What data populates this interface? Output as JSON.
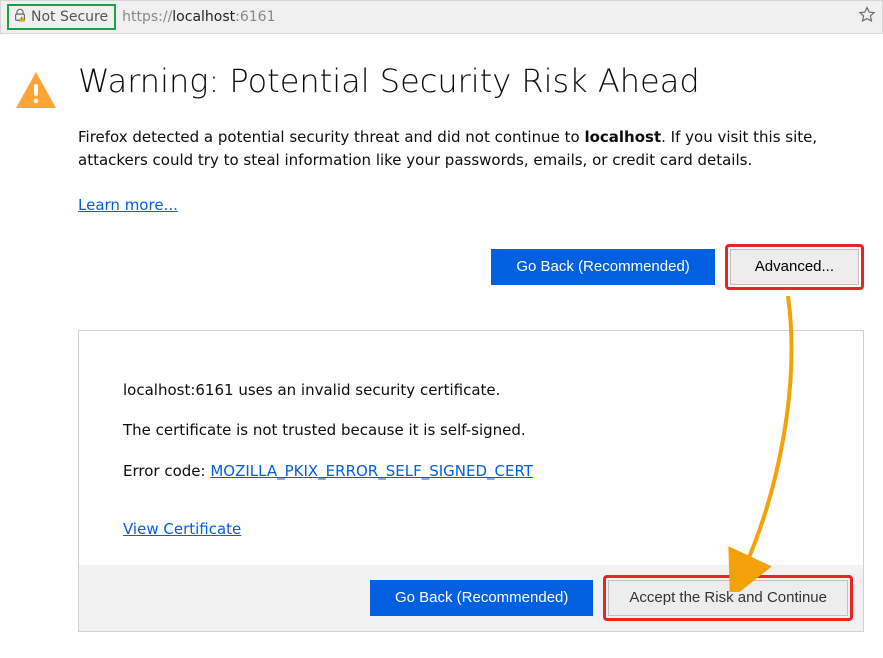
{
  "addressBar": {
    "notSecureLabel": "Not Secure",
    "urlProto": "https://",
    "urlHost": "localhost",
    "urlRest": ":6161"
  },
  "main": {
    "title": "Warning: Potential Security Risk Ahead",
    "warning_pre": "Firefox detected a potential security threat and did not continue to ",
    "warning_host": "localhost",
    "warning_post": ". If you visit this site, attackers could try to steal information like your passwords, emails, or credit card details.",
    "learnMore": "Learn more...",
    "goBack": "Go Back (Recommended)",
    "advanced": "Advanced..."
  },
  "details": {
    "line1": "localhost:6161 uses an invalid security certificate.",
    "line2": "The certificate is not trusted because it is self-signed.",
    "errorLabel": "Error code: ",
    "errorCode": "MOZILLA_PKIX_ERROR_SELF_SIGNED_CERT",
    "viewCert": "View Certificate",
    "goBack": "Go Back (Recommended)",
    "accept": "Accept the Risk and Continue"
  }
}
